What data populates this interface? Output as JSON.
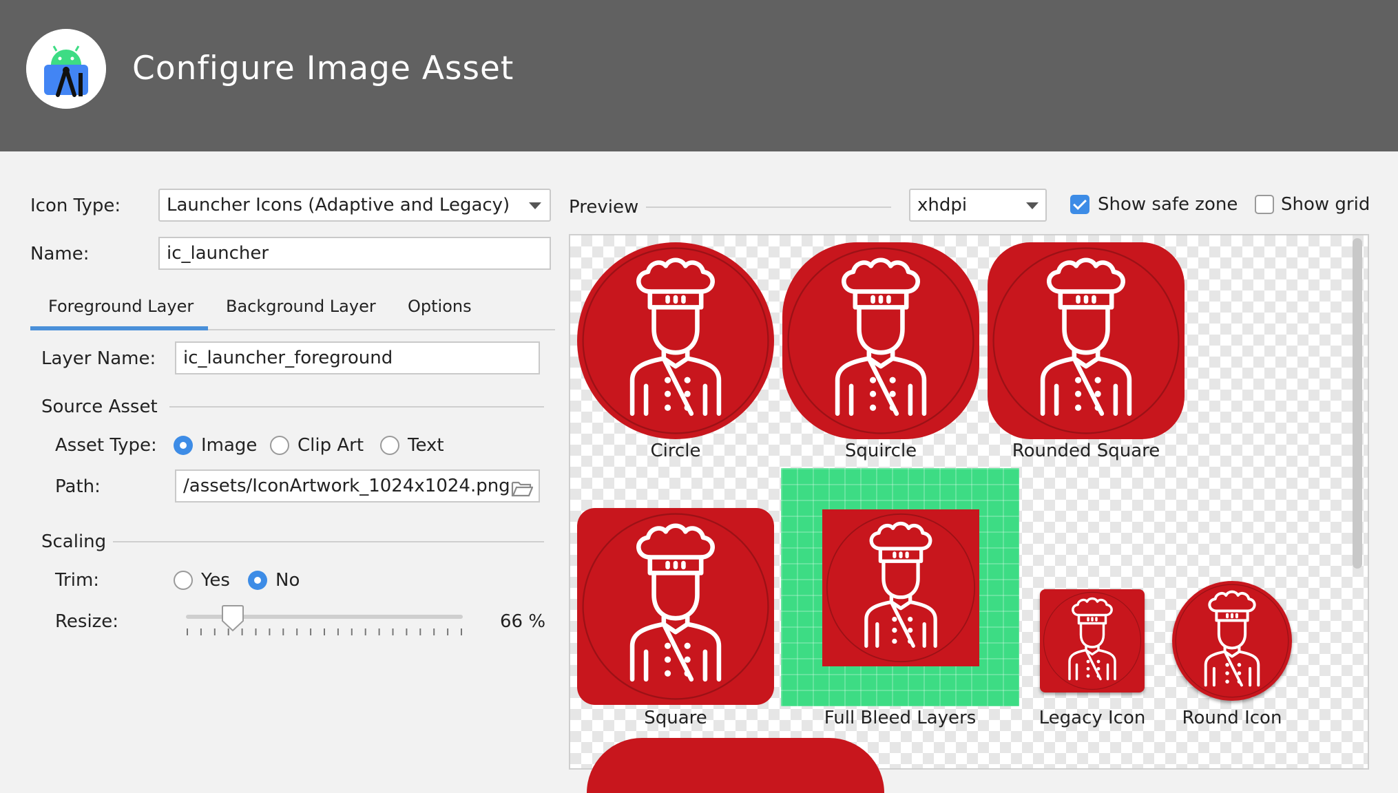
{
  "header": {
    "title": "Configure Image Asset"
  },
  "form": {
    "icon_type_label": "Icon Type:",
    "icon_type_value": "Launcher Icons (Adaptive and Legacy)",
    "name_label": "Name:",
    "name_value": "ic_launcher"
  },
  "tabs": [
    {
      "label": "Foreground Layer",
      "selected": true
    },
    {
      "label": "Background Layer",
      "selected": false
    },
    {
      "label": "Options",
      "selected": false
    }
  ],
  "layer": {
    "layer_name_label": "Layer Name:",
    "layer_name_value": "ic_launcher_foreground",
    "source_asset_label": "Source Asset",
    "asset_type_label": "Asset Type:",
    "asset_type_options": [
      "Image",
      "Clip Art",
      "Text"
    ],
    "asset_type_selected": "Image",
    "path_label": "Path:",
    "path_value": "/assets/IconArtwork_1024x1024.png",
    "scaling_label": "Scaling",
    "trim_label": "Trim:",
    "trim_options": [
      "Yes",
      "No"
    ],
    "trim_selected": "No",
    "resize_label": "Resize:",
    "resize_value": "66 %",
    "resize_percent": 66
  },
  "preview": {
    "label": "Preview",
    "density_value": "xhdpi",
    "show_safe_zone_label": "Show safe zone",
    "show_safe_zone_checked": true,
    "show_grid_label": "Show grid",
    "show_grid_checked": false,
    "captions": {
      "circle": "Circle",
      "squircle": "Squircle",
      "rounded_square": "Rounded Square",
      "square": "Square",
      "full_bleed": "Full Bleed Layers",
      "legacy": "Legacy Icon",
      "round": "Round Icon"
    }
  },
  "colors": {
    "header_bg": "#616161",
    "icon_red": "#c8161d",
    "full_bleed_green": "#3ddc84",
    "accent_blue": "#3d8ce6"
  },
  "icons": {
    "app_logo": "android-studio-logo-icon",
    "folder": "folder-open-icon",
    "dropdown": "chevron-down-icon",
    "chef": "chef-icon"
  }
}
